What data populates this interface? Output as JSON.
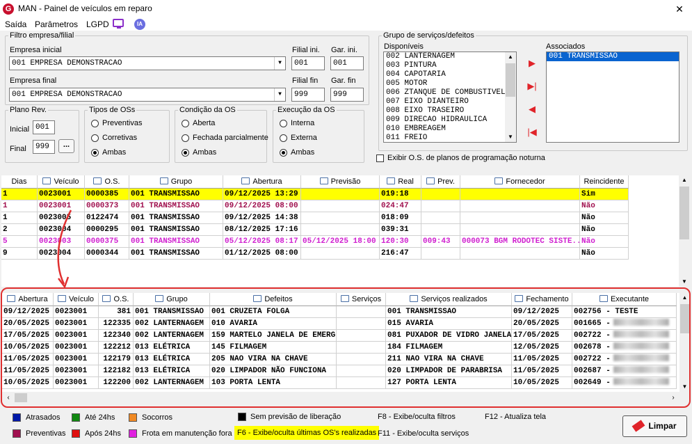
{
  "window": {
    "title": "MAN - Painel de veículos em reparo",
    "close": "✕"
  },
  "menu": {
    "saida": "Saída",
    "parametros": "Parâmetros",
    "lgpd": "LGPD",
    "ia": "IA"
  },
  "filtro": {
    "legend": "Filtro empresa/filial",
    "empresa_inicial_label": "Empresa inicial",
    "empresa_inicial": "001 EMPRESA DEMONSTRACAO",
    "empresa_final_label": "Empresa final",
    "empresa_final": "001 EMPRESA DEMONSTRACAO",
    "filial_ini_label": "Filial ini.",
    "filial_ini": "001",
    "gar_ini_label": "Gar. ini.",
    "gar_ini": "001",
    "filial_fin_label": "Filial fin",
    "filial_fin": "999",
    "gar_fin_label": "Gar. fin",
    "gar_fin": "999"
  },
  "plano": {
    "legend": "Plano Rev.",
    "inicial_label": "Inicial",
    "inicial": "001",
    "final_label": "Final",
    "final": "999",
    "browse": "..."
  },
  "tipos": {
    "legend": "Tipos de OSs",
    "opts": [
      "Preventivas",
      "Corretivas",
      "Ambas"
    ],
    "selected": "Ambas"
  },
  "condicao": {
    "legend": "Condição da OS",
    "opts": [
      "Aberta",
      "Fechada parcialmente",
      "Ambas"
    ],
    "selected": "Ambas"
  },
  "execucao": {
    "legend": "Execução da OS",
    "opts": [
      "Interna",
      "Externa",
      "Ambas"
    ],
    "selected": "Ambas"
  },
  "grupo": {
    "legend": "Grupo de serviços/defeitos",
    "disponiveis_label": "Disponíveis",
    "disponiveis": [
      "002 LANTERNAGEM",
      "003 PINTURA",
      "004 CAPOTARIA",
      "005 MOTOR",
      "006 ZTANQUE DE COMBUSTIVEL",
      "007 EIXO DIANTEIRO",
      "008 EIXO TRASEIRO",
      "009 DIRECAO HIDRAULICA",
      "010 EMBREAGEM",
      "011 FREIO"
    ],
    "associados_label": "Associados",
    "associados": [
      "001 TRANSMISSAO"
    ],
    "exibir_label": "Exibir O.S. de planos de programação noturna"
  },
  "grid1": {
    "headers": [
      "Dias",
      "Veículo",
      "O.S.",
      "Grupo",
      "Abertura",
      "Previsão",
      "Real",
      "Prev.",
      "Fornecedor",
      "Reincidente"
    ],
    "rows": [
      {
        "dias": "1",
        "veiculo": "0023001",
        "os": "0000385",
        "grupo": "001  TRANSMISSAO",
        "abertura": "09/12/2025 13:29",
        "previsao": "",
        "real": "019:18",
        "prev": "",
        "fornecedor": "",
        "reinc": "Sim",
        "color": "#000000",
        "bg": "#ffff00"
      },
      {
        "dias": "1",
        "veiculo": "0023001",
        "os": "0000373",
        "grupo": "001  TRANSMISSAO",
        "abertura": "09/12/2025 08:00",
        "previsao": "",
        "real": "024:47",
        "prev": "",
        "fornecedor": "",
        "reinc": "Não",
        "color": "#a0104f",
        "bg": "#ffffff"
      },
      {
        "dias": "1",
        "veiculo": "0023005",
        "os": "0122474",
        "grupo": "001  TRANSMISSAO",
        "abertura": "09/12/2025 14:38",
        "previsao": "",
        "real": "018:09",
        "prev": "",
        "fornecedor": "",
        "reinc": "Não",
        "color": "#000000",
        "bg": "#ffffff"
      },
      {
        "dias": "2",
        "veiculo": "0023004",
        "os": "0000295",
        "grupo": "001  TRANSMISSAO",
        "abertura": "08/12/2025 17:16",
        "previsao": "",
        "real": "039:31",
        "prev": "",
        "fornecedor": "",
        "reinc": "Não",
        "color": "#000000",
        "bg": "#ffffff"
      },
      {
        "dias": "5",
        "veiculo": "0023003",
        "os": "0000375",
        "grupo": "001  TRANSMISSAO",
        "abertura": "05/12/2025 08:17",
        "previsao": "05/12/2025 18:00",
        "real": "120:30",
        "prev": "009:43",
        "fornecedor": "000073  BGM RODOTEC SISTE...",
        "reinc": "Não",
        "color": "#d020d0",
        "bg": "#ffffff"
      },
      {
        "dias": "9",
        "veiculo": "0023004",
        "os": "0000344",
        "grupo": "001  TRANSMISSAO",
        "abertura": "01/12/2025 08:00",
        "previsao": "",
        "real": "216:47",
        "prev": "",
        "fornecedor": "",
        "reinc": "Não",
        "color": "#000000",
        "bg": "#ffffff"
      }
    ]
  },
  "grid2": {
    "headers": [
      "Abertura",
      "Veículo",
      "O.S.",
      "Grupo",
      "Defeitos",
      "Serviços",
      "Serviços realizados",
      "Fechamento",
      "Executante"
    ],
    "rows": [
      {
        "abertura": "09/12/2025",
        "veiculo": "0023001",
        "os": "381",
        "grupo": "001 TRANSMISSAO",
        "defeito": "001 CRUZETA FOLGA",
        "servicos": "",
        "realizados": "001 TRANSMISSAO",
        "fechamento": "09/12/2025",
        "executante": "002756 - TESTE",
        "blur": false
      },
      {
        "abertura": "20/05/2025",
        "veiculo": "0023001",
        "os": "122335",
        "grupo": "002 LANTERNAGEM",
        "defeito": "010 AVARIA",
        "servicos": "",
        "realizados": "015 AVARIA",
        "fechamento": "20/05/2025",
        "executante": "001665 -",
        "blur": true
      },
      {
        "abertura": "17/05/2025",
        "veiculo": "0023001",
        "os": "122340",
        "grupo": "002 LANTERNAGEM",
        "defeito": "159 MARTELO JANELA DE EMERG",
        "servicos": "",
        "realizados": "081 PUXADOR DE VIDRO JANELA",
        "fechamento": "17/05/2025",
        "executante": "002722 -",
        "blur": true
      },
      {
        "abertura": "10/05/2025",
        "veiculo": "0023001",
        "os": "122212",
        "grupo": "013 ELÉTRICA",
        "defeito": "145 FILMAGEM",
        "servicos": "",
        "realizados": "184 FILMAGEM",
        "fechamento": "12/05/2025",
        "executante": "002678 -",
        "blur": true
      },
      {
        "abertura": "11/05/2025",
        "veiculo": "0023001",
        "os": "122179",
        "grupo": "013 ELÉTRICA",
        "defeito": "205 NAO VIRA NA CHAVE",
        "servicos": "",
        "realizados": "211 NAO VIRA NA CHAVE",
        "fechamento": "11/05/2025",
        "executante": "002722 -",
        "blur": true
      },
      {
        "abertura": "11/05/2025",
        "veiculo": "0023001",
        "os": "122182",
        "grupo": "013 ELÉTRICA",
        "defeito": "020 LIMPADOR NÃO FUNCIONA",
        "servicos": "",
        "realizados": "020 LIMPADOR DE PARABRISA",
        "fechamento": "11/05/2025",
        "executante": "002687 -",
        "blur": true
      },
      {
        "abertura": "10/05/2025",
        "veiculo": "0023001",
        "os": "122200",
        "grupo": "002 LANTERNAGEM",
        "defeito": "103 PORTA LENTA",
        "servicos": "",
        "realizados": "127 PORTA LENTA",
        "fechamento": "10/05/2025",
        "executante": "002649 -",
        "blur": true
      }
    ]
  },
  "legend": {
    "atrasados": "Atrasados",
    "ate24": "Até 24hs",
    "socorros": "Socorros",
    "sem_previsao": "Sem previsão de liberação",
    "preventivas": "Preventivas",
    "apos24": "Após 24hs",
    "frota": "Frota em manutenção fora",
    "f6": "F6 - Exibe/oculta últimas OS's realizadas",
    "f8": "F8 - Exibe/oculta filtros",
    "f11": "F11 - Exibe/oculta serviços",
    "f12": "F12 - Atualiza tela",
    "colors": {
      "atrasados": "#0018a8",
      "ate24": "#118811",
      "socorros": "#f08a24",
      "sem_previsao": "#000000",
      "preventivas": "#a0104f",
      "apos24": "#e01010",
      "frota": "#e020e0",
      "f6_bg": "#ffff00"
    }
  },
  "limpar": "Limpar"
}
